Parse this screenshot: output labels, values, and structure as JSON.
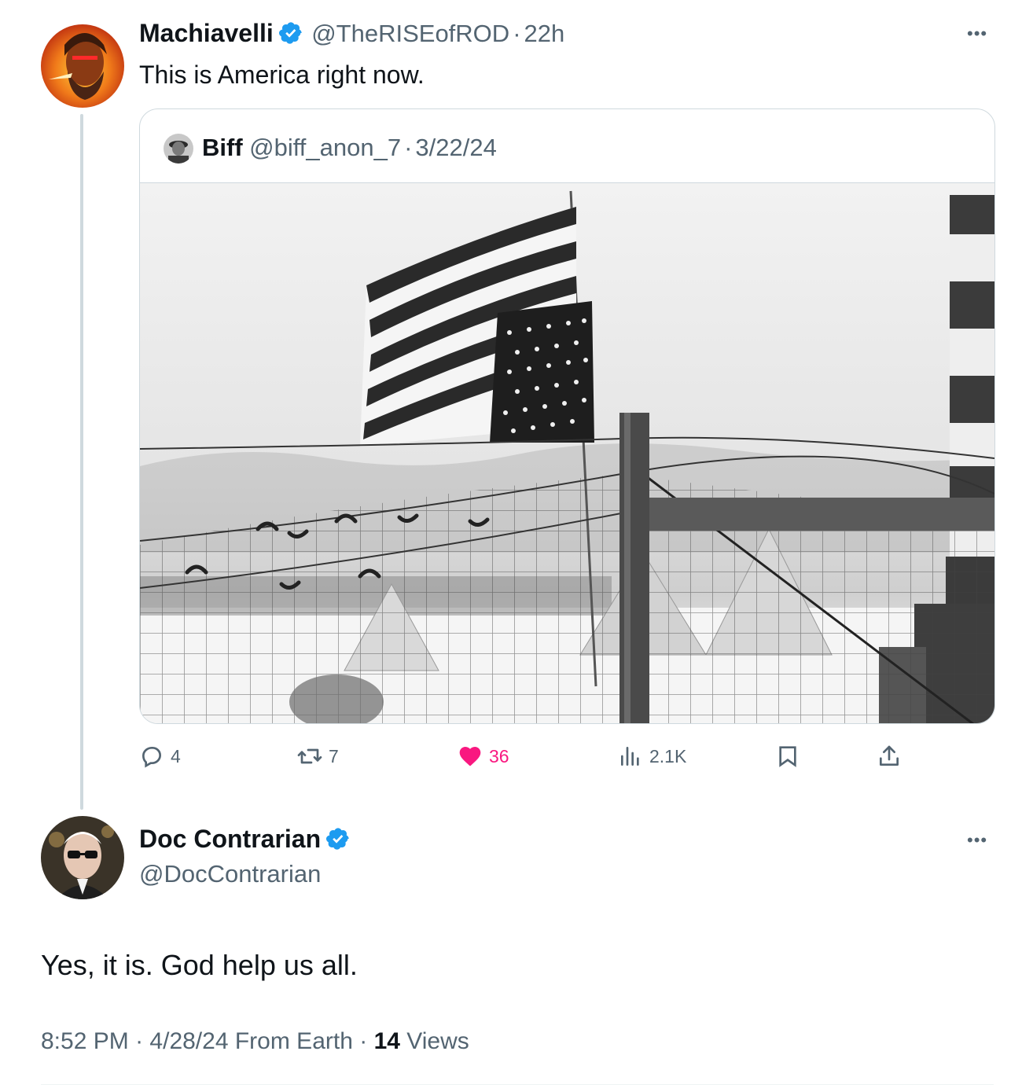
{
  "parent_tweet": {
    "display_name": "Machiavelli",
    "handle": "@TheRISEofROD",
    "separator": "·",
    "time": "22h",
    "text": "This is America right now.",
    "verified": true,
    "more_icon": "more-horizontal-icon",
    "quote": {
      "display_name": "Biff",
      "handle": "@biff_anon_7",
      "separator": "·",
      "date": "3/22/24",
      "media_description_icon": "photo"
    },
    "actions": {
      "replies": "4",
      "reposts": "7",
      "likes": "36",
      "views": "2.1K"
    },
    "colors": {
      "like_active": "#f91880",
      "verified_blue": "#1d9bf0",
      "secondary_text": "#536471"
    }
  },
  "reply_tweet": {
    "display_name": "Doc Contrarian",
    "handle": "@DocContrarian",
    "verified": true,
    "text": "Yes, it is. God help us all.",
    "time": "8:52 PM",
    "date": "4/28/24",
    "source": "From Earth",
    "sep1": "·",
    "sep2": "·",
    "views_count": "14",
    "views_label": "Views"
  }
}
